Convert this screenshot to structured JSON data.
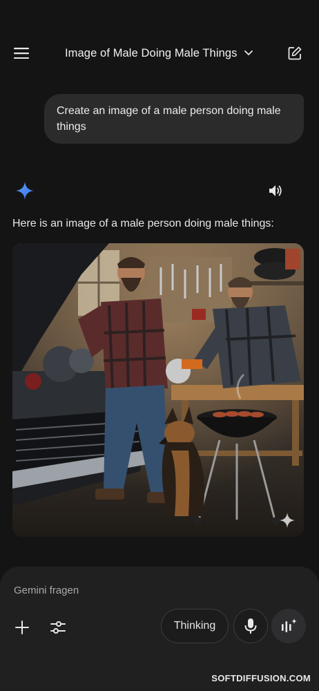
{
  "header": {
    "menu_icon": "hamburger-menu-icon",
    "title": "Image of Male Doing Male Things",
    "title_dropdown_icon": "chevron-down-icon",
    "new_chat_icon": "edit-square-icon"
  },
  "conversation": {
    "user_message": "Create an image of a male person doing male things",
    "assistant_icon": "gemini-sparkle-icon",
    "speaker_icon": "volume-icon",
    "response_text": "Here is an image of a male person doing male things:",
    "image_description_icon": "sparkle-watermark-icon"
  },
  "composer": {
    "placeholder": "Gemini fragen",
    "add_icon": "plus-icon",
    "tools_icon": "tune-icon",
    "thinking_label": "Thinking",
    "mic_icon": "microphone-icon",
    "live_icon": "live-waveform-icon"
  },
  "watermark": "SOFTDIFFUSION.COM",
  "colors": {
    "background": "#141414",
    "bubble": "#2b2b2c",
    "composer": "#202021",
    "gemini_blue": "#4c8df6"
  }
}
